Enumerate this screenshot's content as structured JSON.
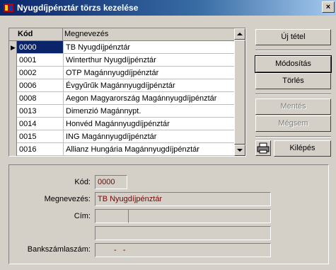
{
  "window": {
    "title": "Nyugdíjpénztár törzs kezelése",
    "close_glyph": "×"
  },
  "grid": {
    "columns": [
      "Kód",
      "Megnevezés"
    ],
    "rows": [
      {
        "code": "0000",
        "name": "TB Nyugdíjpénztár",
        "selected": true
      },
      {
        "code": "0001",
        "name": "Winterthur Nyugdíjpénztár"
      },
      {
        "code": "0002",
        "name": "OTP Magánnyugdíjpénztár"
      },
      {
        "code": "0006",
        "name": "Évgyűrűk Magánnyugdíjpénztár"
      },
      {
        "code": "0008",
        "name": "Aegon Magyarország Magánnyugdíjpénztár"
      },
      {
        "code": "0013",
        "name": "Dimenzió Magánnypt."
      },
      {
        "code": "0014",
        "name": "Honvéd Magánnyugdíjpénztár"
      },
      {
        "code": "0015",
        "name": "ING Magánnyugdíjpénztár"
      },
      {
        "code": "0016",
        "name": "Allianz Hungária Magánnyugdíjpénztár"
      }
    ],
    "row_marker": "▶"
  },
  "buttons": {
    "new": "Új tétel",
    "modify": "Módosítás",
    "delete": "Törlés",
    "save": "Mentés",
    "cancel": "Mégsem",
    "exit": "Kilépés"
  },
  "detail": {
    "code_label": "Kód:",
    "code_value": "0000",
    "name_label": "Megnevezés:",
    "name_value": "TB Nyugdíjpénztár",
    "address_label": "Cím:",
    "address_zip": "",
    "address_city": "",
    "address_street": "",
    "bank_label": "Bankszámlaszám:",
    "bank_value": "-   -"
  },
  "icons": {
    "app": "app-icon",
    "print": "printer-icon"
  },
  "colors": {
    "title_bar": "#0a246a",
    "selection": "#0a246a",
    "field_text": "#800000"
  }
}
